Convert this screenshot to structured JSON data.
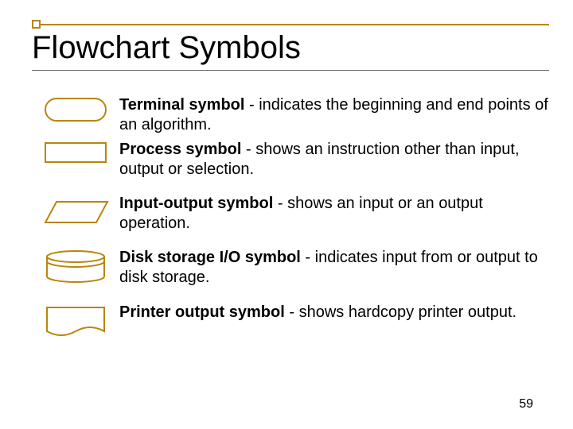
{
  "title": "Flowchart Symbols",
  "items": [
    {
      "name": "Terminal symbol",
      "desc": " - indicates the beginning and end points of an algorithm."
    },
    {
      "name": "Process symbol",
      "desc": " - shows an instruction other than input, output or selection."
    },
    {
      "name": "Input-output symbol",
      "desc": " - shows an input or an output operation."
    },
    {
      "name": "Disk storage I/O symbol",
      "desc": " - indicates input from or output to disk storage."
    },
    {
      "name": "Printer output symbol",
      "desc": " - shows hardcopy printer output."
    }
  ],
  "page_number": "59"
}
